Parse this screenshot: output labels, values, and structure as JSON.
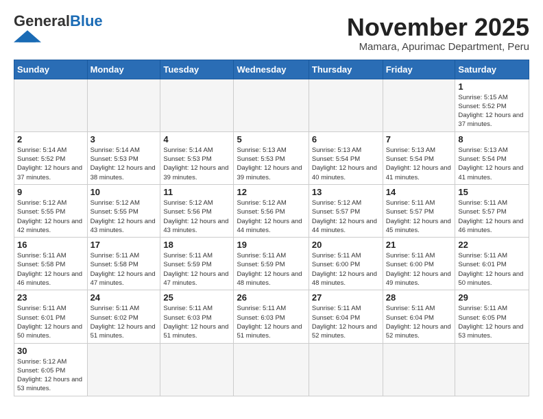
{
  "logo": {
    "general": "General",
    "blue": "Blue"
  },
  "title": "November 2025",
  "subtitle": "Mamara, Apurimac Department, Peru",
  "days_of_week": [
    "Sunday",
    "Monday",
    "Tuesday",
    "Wednesday",
    "Thursday",
    "Friday",
    "Saturday"
  ],
  "weeks": [
    [
      {
        "day": "",
        "info": ""
      },
      {
        "day": "",
        "info": ""
      },
      {
        "day": "",
        "info": ""
      },
      {
        "day": "",
        "info": ""
      },
      {
        "day": "",
        "info": ""
      },
      {
        "day": "",
        "info": ""
      },
      {
        "day": "1",
        "info": "Sunrise: 5:15 AM\nSunset: 5:52 PM\nDaylight: 12 hours and 37 minutes."
      }
    ],
    [
      {
        "day": "2",
        "info": "Sunrise: 5:14 AM\nSunset: 5:52 PM\nDaylight: 12 hours and 37 minutes."
      },
      {
        "day": "3",
        "info": "Sunrise: 5:14 AM\nSunset: 5:53 PM\nDaylight: 12 hours and 38 minutes."
      },
      {
        "day": "4",
        "info": "Sunrise: 5:14 AM\nSunset: 5:53 PM\nDaylight: 12 hours and 39 minutes."
      },
      {
        "day": "5",
        "info": "Sunrise: 5:13 AM\nSunset: 5:53 PM\nDaylight: 12 hours and 39 minutes."
      },
      {
        "day": "6",
        "info": "Sunrise: 5:13 AM\nSunset: 5:54 PM\nDaylight: 12 hours and 40 minutes."
      },
      {
        "day": "7",
        "info": "Sunrise: 5:13 AM\nSunset: 5:54 PM\nDaylight: 12 hours and 41 minutes."
      },
      {
        "day": "8",
        "info": "Sunrise: 5:13 AM\nSunset: 5:54 PM\nDaylight: 12 hours and 41 minutes."
      }
    ],
    [
      {
        "day": "9",
        "info": "Sunrise: 5:12 AM\nSunset: 5:55 PM\nDaylight: 12 hours and 42 minutes."
      },
      {
        "day": "10",
        "info": "Sunrise: 5:12 AM\nSunset: 5:55 PM\nDaylight: 12 hours and 43 minutes."
      },
      {
        "day": "11",
        "info": "Sunrise: 5:12 AM\nSunset: 5:56 PM\nDaylight: 12 hours and 43 minutes."
      },
      {
        "day": "12",
        "info": "Sunrise: 5:12 AM\nSunset: 5:56 PM\nDaylight: 12 hours and 44 minutes."
      },
      {
        "day": "13",
        "info": "Sunrise: 5:12 AM\nSunset: 5:57 PM\nDaylight: 12 hours and 44 minutes."
      },
      {
        "day": "14",
        "info": "Sunrise: 5:11 AM\nSunset: 5:57 PM\nDaylight: 12 hours and 45 minutes."
      },
      {
        "day": "15",
        "info": "Sunrise: 5:11 AM\nSunset: 5:57 PM\nDaylight: 12 hours and 46 minutes."
      }
    ],
    [
      {
        "day": "16",
        "info": "Sunrise: 5:11 AM\nSunset: 5:58 PM\nDaylight: 12 hours and 46 minutes."
      },
      {
        "day": "17",
        "info": "Sunrise: 5:11 AM\nSunset: 5:58 PM\nDaylight: 12 hours and 47 minutes."
      },
      {
        "day": "18",
        "info": "Sunrise: 5:11 AM\nSunset: 5:59 PM\nDaylight: 12 hours and 47 minutes."
      },
      {
        "day": "19",
        "info": "Sunrise: 5:11 AM\nSunset: 5:59 PM\nDaylight: 12 hours and 48 minutes."
      },
      {
        "day": "20",
        "info": "Sunrise: 5:11 AM\nSunset: 6:00 PM\nDaylight: 12 hours and 48 minutes."
      },
      {
        "day": "21",
        "info": "Sunrise: 5:11 AM\nSunset: 6:00 PM\nDaylight: 12 hours and 49 minutes."
      },
      {
        "day": "22",
        "info": "Sunrise: 5:11 AM\nSunset: 6:01 PM\nDaylight: 12 hours and 50 minutes."
      }
    ],
    [
      {
        "day": "23",
        "info": "Sunrise: 5:11 AM\nSunset: 6:01 PM\nDaylight: 12 hours and 50 minutes."
      },
      {
        "day": "24",
        "info": "Sunrise: 5:11 AM\nSunset: 6:02 PM\nDaylight: 12 hours and 51 minutes."
      },
      {
        "day": "25",
        "info": "Sunrise: 5:11 AM\nSunset: 6:03 PM\nDaylight: 12 hours and 51 minutes."
      },
      {
        "day": "26",
        "info": "Sunrise: 5:11 AM\nSunset: 6:03 PM\nDaylight: 12 hours and 51 minutes."
      },
      {
        "day": "27",
        "info": "Sunrise: 5:11 AM\nSunset: 6:04 PM\nDaylight: 12 hours and 52 minutes."
      },
      {
        "day": "28",
        "info": "Sunrise: 5:11 AM\nSunset: 6:04 PM\nDaylight: 12 hours and 52 minutes."
      },
      {
        "day": "29",
        "info": "Sunrise: 5:11 AM\nSunset: 6:05 PM\nDaylight: 12 hours and 53 minutes."
      }
    ],
    [
      {
        "day": "30",
        "info": "Sunrise: 5:12 AM\nSunset: 6:05 PM\nDaylight: 12 hours and 53 minutes."
      },
      {
        "day": "",
        "info": ""
      },
      {
        "day": "",
        "info": ""
      },
      {
        "day": "",
        "info": ""
      },
      {
        "day": "",
        "info": ""
      },
      {
        "day": "",
        "info": ""
      },
      {
        "day": "",
        "info": ""
      }
    ]
  ]
}
